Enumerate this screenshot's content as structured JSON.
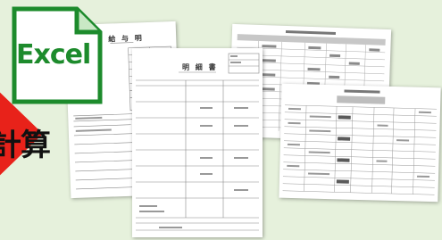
{
  "excel_icon": {
    "label": "Excel",
    "color": "#1d8b2c"
  },
  "arrow": {
    "text": "計算",
    "color": "#e8221a"
  },
  "documents": {
    "salary_slip": {
      "title": "給 与 明"
    },
    "detail_sheet": {
      "title": "明 細 書"
    }
  }
}
